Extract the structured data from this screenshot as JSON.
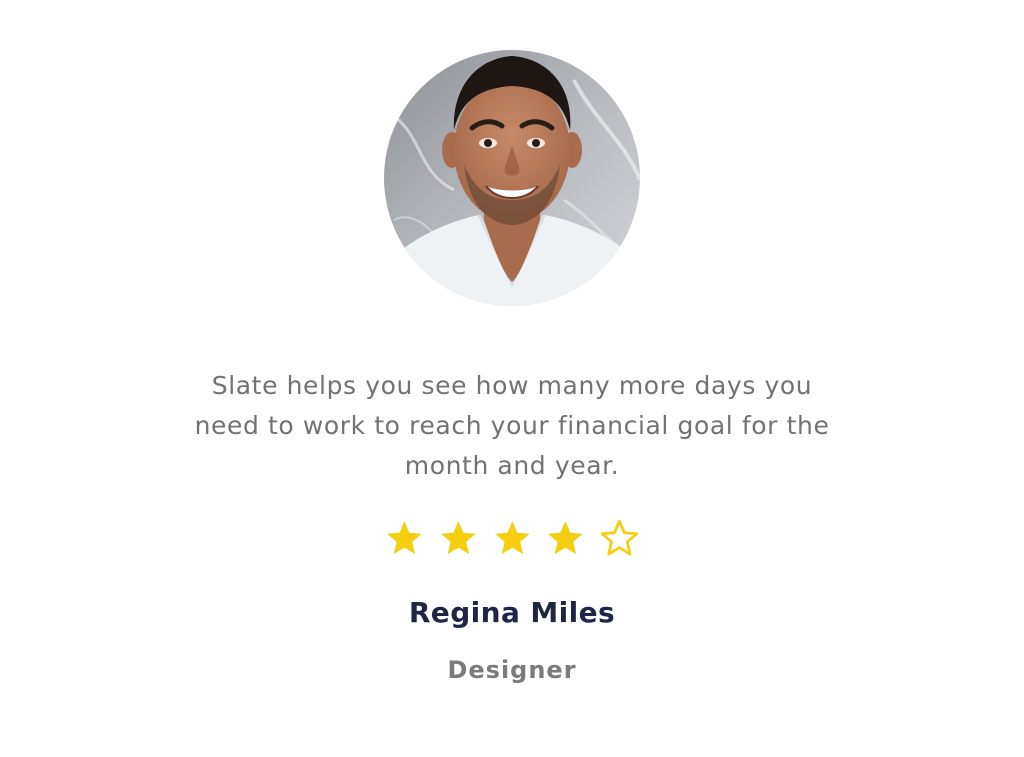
{
  "testimonial": {
    "quote": "Slate helps you see how many more days you need to work to reach your financial goal for the month and year.",
    "author_name": "Regina Miles",
    "author_role": "Designer"
  },
  "rating": {
    "value": 4,
    "max": 5,
    "filled_icon": "star-filled-icon",
    "empty_icon": "star-outline-icon",
    "color": "#f5cf0f"
  },
  "avatar": {
    "icon": "avatar-photo",
    "alt": "Portrait of smiling man in white t-shirt"
  },
  "colors": {
    "quote_text": "#727272",
    "name_text": "#1f2645",
    "role_text": "#7b7b7b",
    "star": "#f5cf0f"
  }
}
